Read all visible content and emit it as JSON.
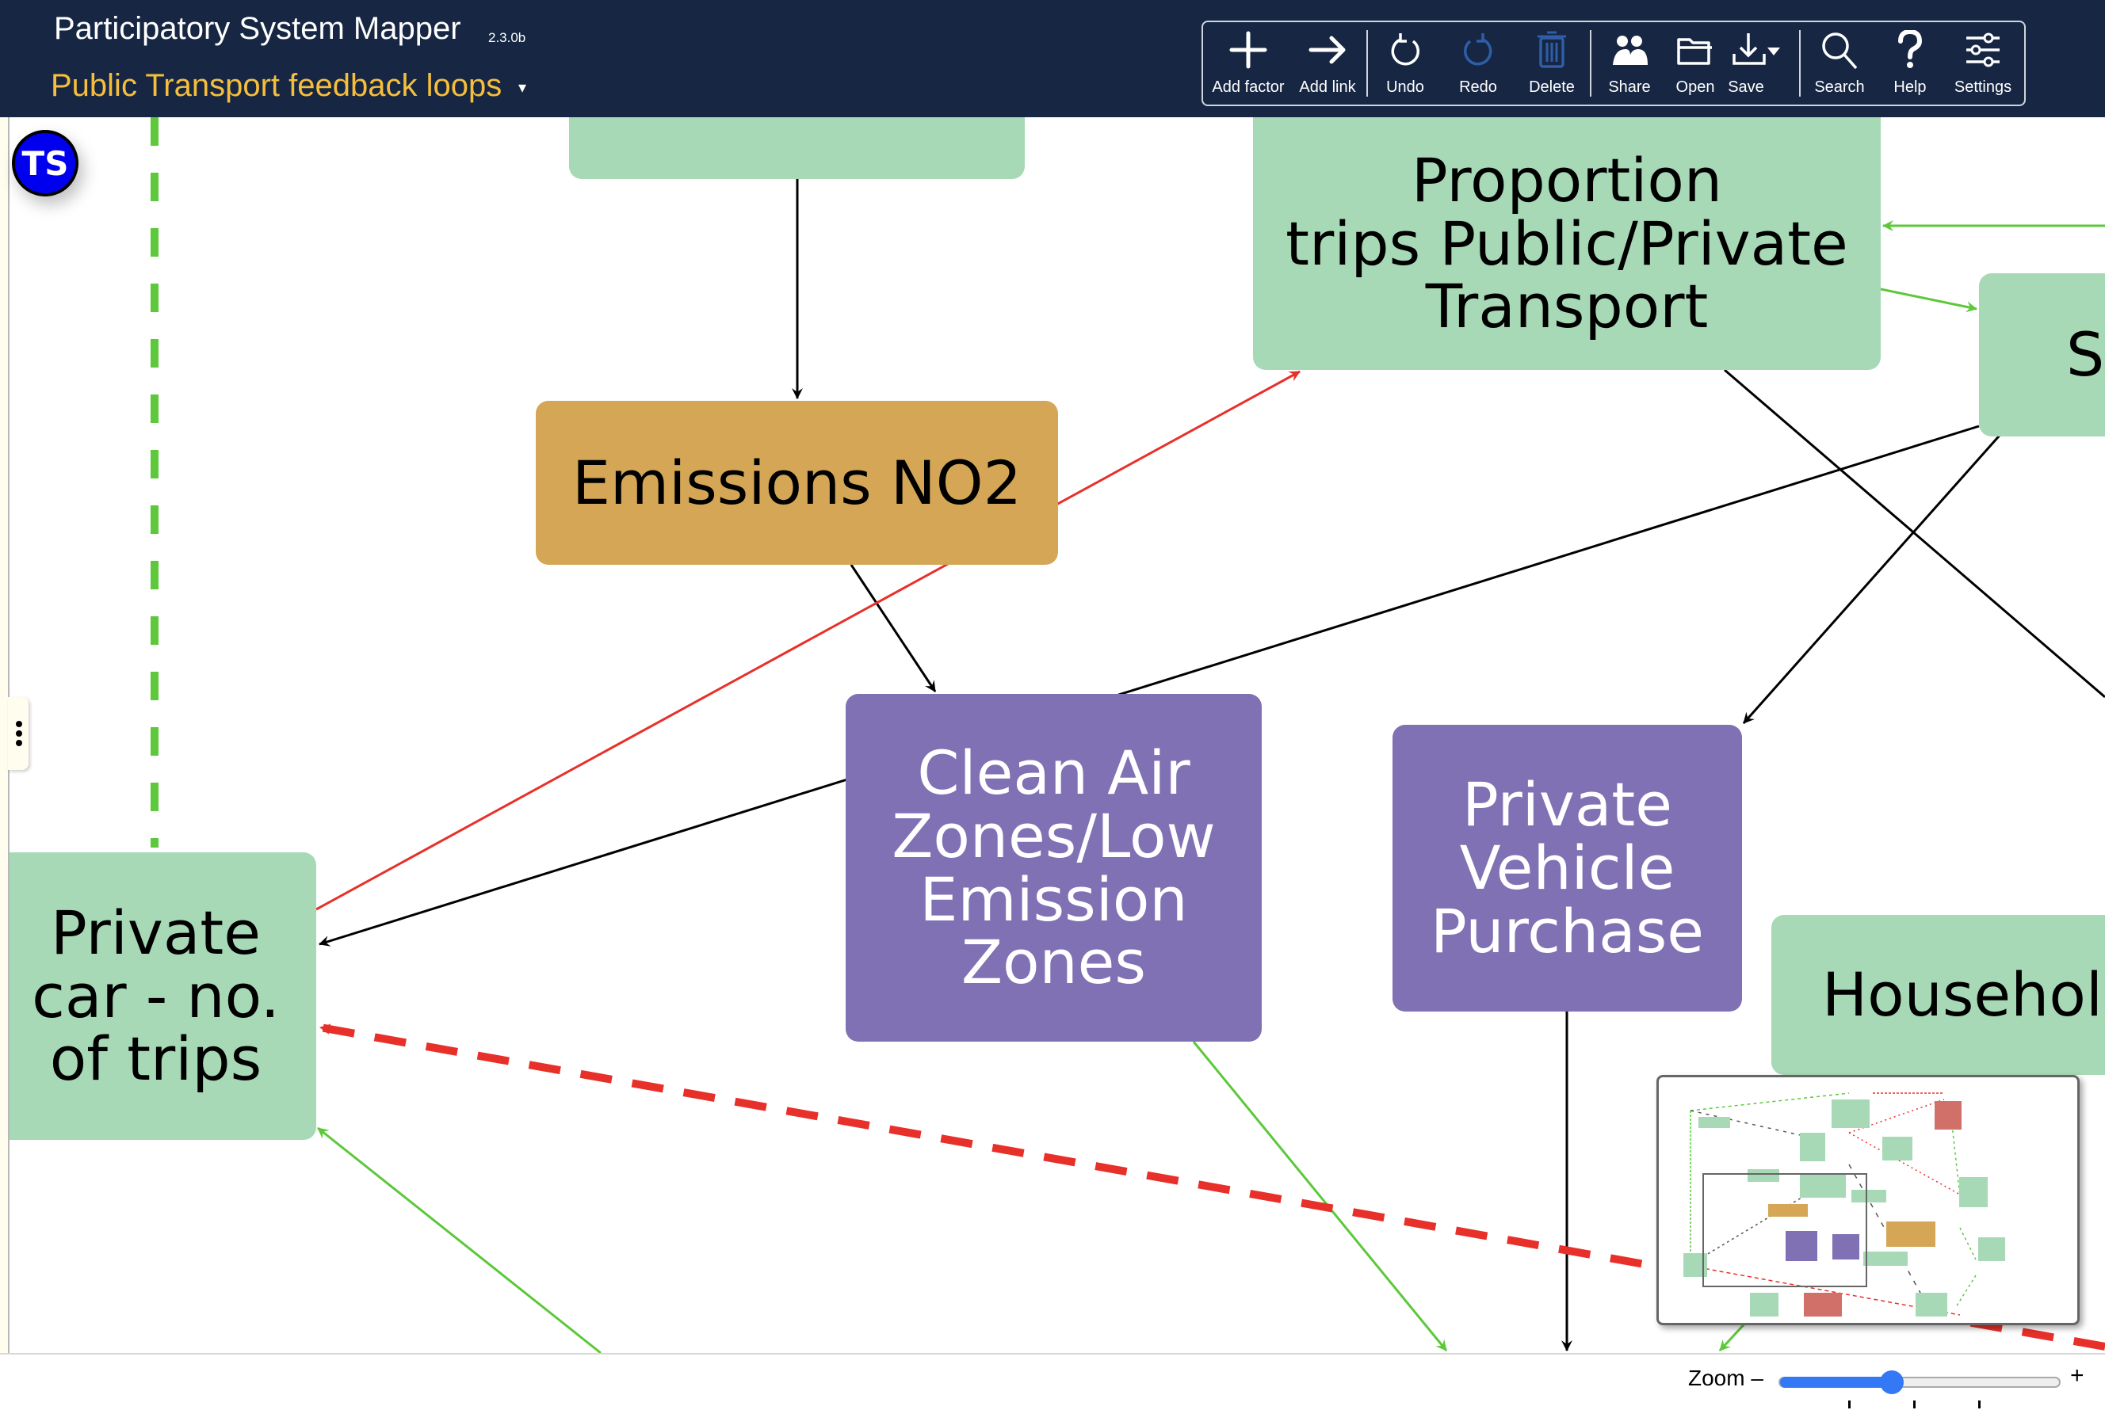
{
  "app": {
    "title": "Participatory System Mapper",
    "version": "2.3.0b",
    "map_title": "Public Transport feedback loops",
    "map_title_caret": "▾"
  },
  "toolbar": {
    "items": [
      {
        "id": "add-factor",
        "label": "Add factor",
        "icon": "plus-icon",
        "enabled": true
      },
      {
        "id": "add-link",
        "label": "Add link",
        "icon": "arrow-right-icon",
        "enabled": true
      },
      {
        "id": "undo",
        "label": "Undo",
        "icon": "undo-icon",
        "enabled": true
      },
      {
        "id": "redo",
        "label": "Redo",
        "icon": "redo-icon",
        "enabled": false
      },
      {
        "id": "delete",
        "label": "Delete",
        "icon": "trash-icon",
        "enabled": false
      },
      {
        "id": "share",
        "label": "Share",
        "icon": "people-icon",
        "enabled": true
      },
      {
        "id": "open",
        "label": "Open",
        "icon": "folder-icon",
        "enabled": true
      },
      {
        "id": "save",
        "label": "Save",
        "icon": "download-icon",
        "enabled": true
      },
      {
        "id": "search",
        "label": "Search",
        "icon": "search-icon",
        "enabled": true
      },
      {
        "id": "help",
        "label": "Help",
        "icon": "question-icon",
        "enabled": true
      },
      {
        "id": "settings",
        "label": "Settings",
        "icon": "sliders-icon",
        "enabled": true
      }
    ]
  },
  "avatar": {
    "initials": "TS",
    "color": "#0000EE"
  },
  "colors": {
    "navbar": "#162643",
    "map_title": "#F5BE3C",
    "node_green": "#A7D9B6",
    "node_gold": "#D4A656",
    "node_purple": "#7F71B3",
    "edge_black": "#000000",
    "edge_red": "#E8302A",
    "edge_green": "#5CC83A",
    "slider": "#3478F6",
    "disabled_icon": "#2F5DA8"
  },
  "nodes": [
    {
      "id": "top-partial",
      "label": "",
      "style": "green"
    },
    {
      "id": "emissions-no2",
      "label": "Emissions NO2",
      "style": "gold"
    },
    {
      "id": "proportion-trips",
      "label": "Proportion\ntrips Public/Private\nTransport",
      "style": "green"
    },
    {
      "id": "so-partial",
      "label": "So",
      "style": "green"
    },
    {
      "id": "clean-air-zones",
      "label": "Clean Air\nZones/Low\nEmission\nZones",
      "style": "purple"
    },
    {
      "id": "private-vehicle-purchase",
      "label": "Private\nVehicle\nPurchase",
      "style": "purple"
    },
    {
      "id": "household-partial",
      "label": "Househol",
      "style": "green"
    },
    {
      "id": "private-car-trips",
      "label": "Private\ncar - no.\nof trips",
      "style": "green"
    }
  ],
  "zoom": {
    "label": "Zoom –",
    "plus": "+",
    "level_fraction": 0.4
  }
}
